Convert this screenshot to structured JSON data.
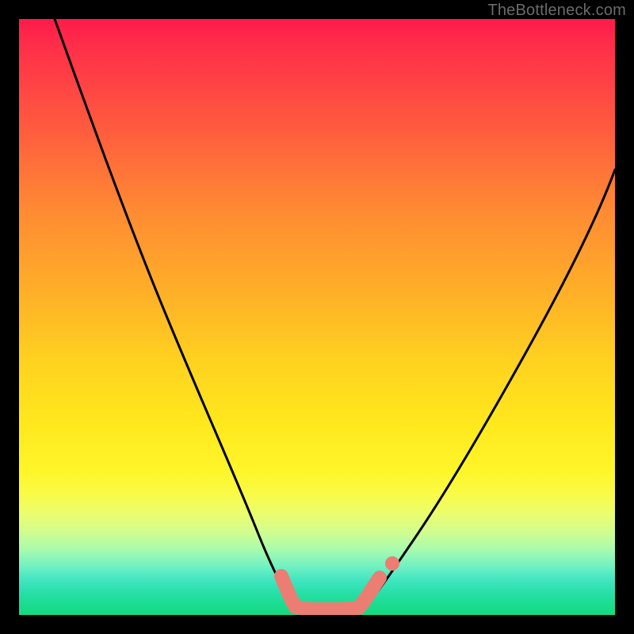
{
  "watermark": "TheBottleneck.com",
  "chart_data": {
    "type": "line",
    "title": "",
    "xlabel": "",
    "ylabel": "",
    "xlim": [
      0,
      100
    ],
    "ylim": [
      0,
      100
    ],
    "grid": false,
    "legend": false,
    "series": [
      {
        "name": "left-curve",
        "x": [
          6,
          12,
          18,
          24,
          30,
          36,
          40,
          44,
          46.5
        ],
        "y": [
          100,
          83,
          67,
          52,
          38,
          24,
          14,
          6,
          2
        ],
        "color": "#000000"
      },
      {
        "name": "right-curve",
        "x": [
          58,
          62,
          66,
          72,
          78,
          84,
          90,
          96,
          100
        ],
        "y": [
          2,
          6,
          12,
          22,
          33,
          45,
          57,
          68,
          75
        ],
        "color": "#000000"
      },
      {
        "name": "plateau-highlight",
        "x": [
          44,
          46,
          46.5,
          49,
          54,
          57,
          58.5,
          60.5
        ],
        "y": [
          6.5,
          3,
          1.5,
          1,
          1,
          1.5,
          3,
          6
        ],
        "color": "#ec7d72"
      }
    ],
    "gradient_stops": [
      {
        "pos": 0,
        "color": "#ff1b4a"
      },
      {
        "pos": 50,
        "color": "#ffc222"
      },
      {
        "pos": 80,
        "color": "#fff83a"
      },
      {
        "pos": 100,
        "color": "#15da7e"
      }
    ]
  }
}
